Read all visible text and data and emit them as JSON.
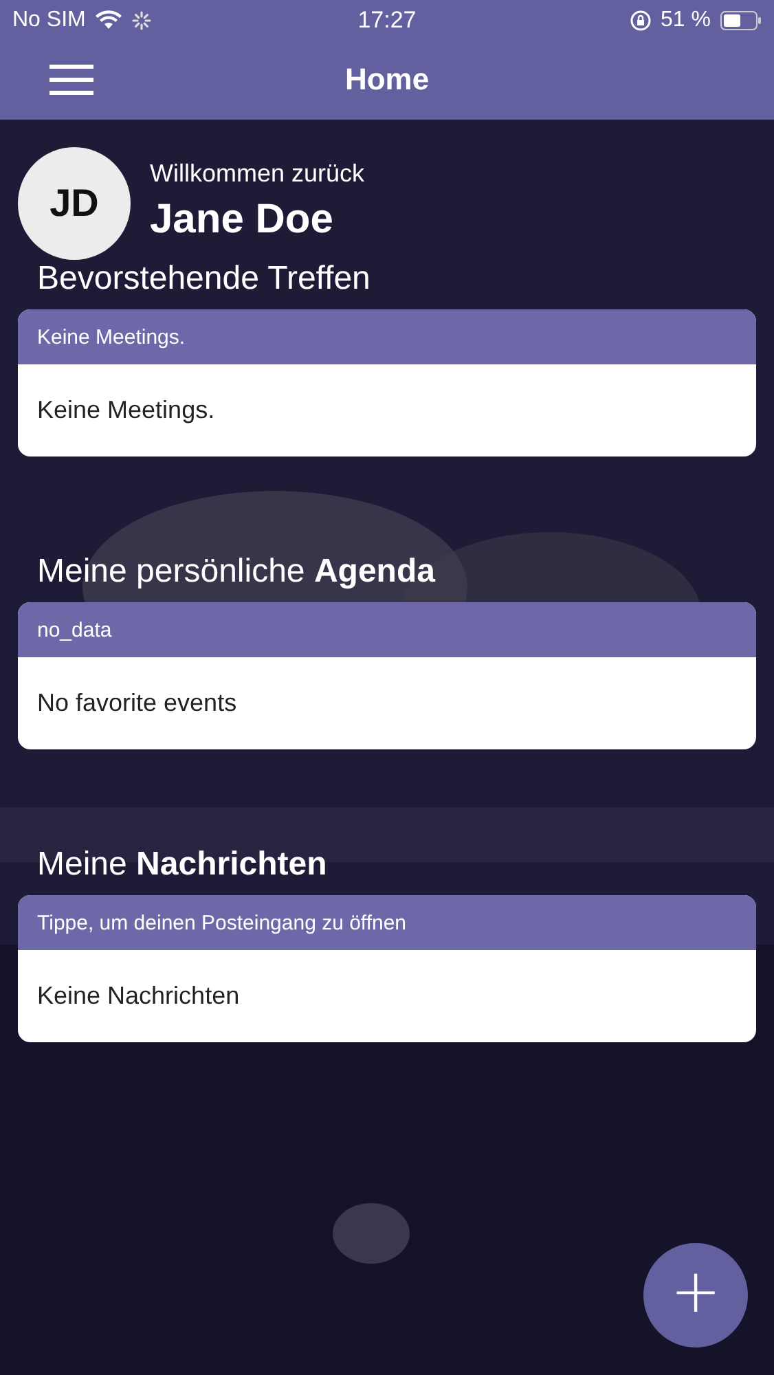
{
  "status_bar": {
    "carrier": "No SIM",
    "time": "17:27",
    "battery": "51 %"
  },
  "nav": {
    "title": "Home"
  },
  "profile": {
    "initials": "JD",
    "greeting": "Willkommen zurück",
    "name": "Jane Doe"
  },
  "sections": [
    {
      "title": "Bevorstehende Treffen",
      "header": "Keine Meetings.",
      "body": "Keine Meetings."
    },
    {
      "title": "Meine persönliche **Agenda**",
      "header": "no_data",
      "body": "No favorite events"
    },
    {
      "title": "Meine **Nachrichten**",
      "header": "Tippe, um deinen Posteingang zu öffnen",
      "body": "Keine Nachrichten"
    }
  ],
  "fab": {
    "label": "+"
  }
}
